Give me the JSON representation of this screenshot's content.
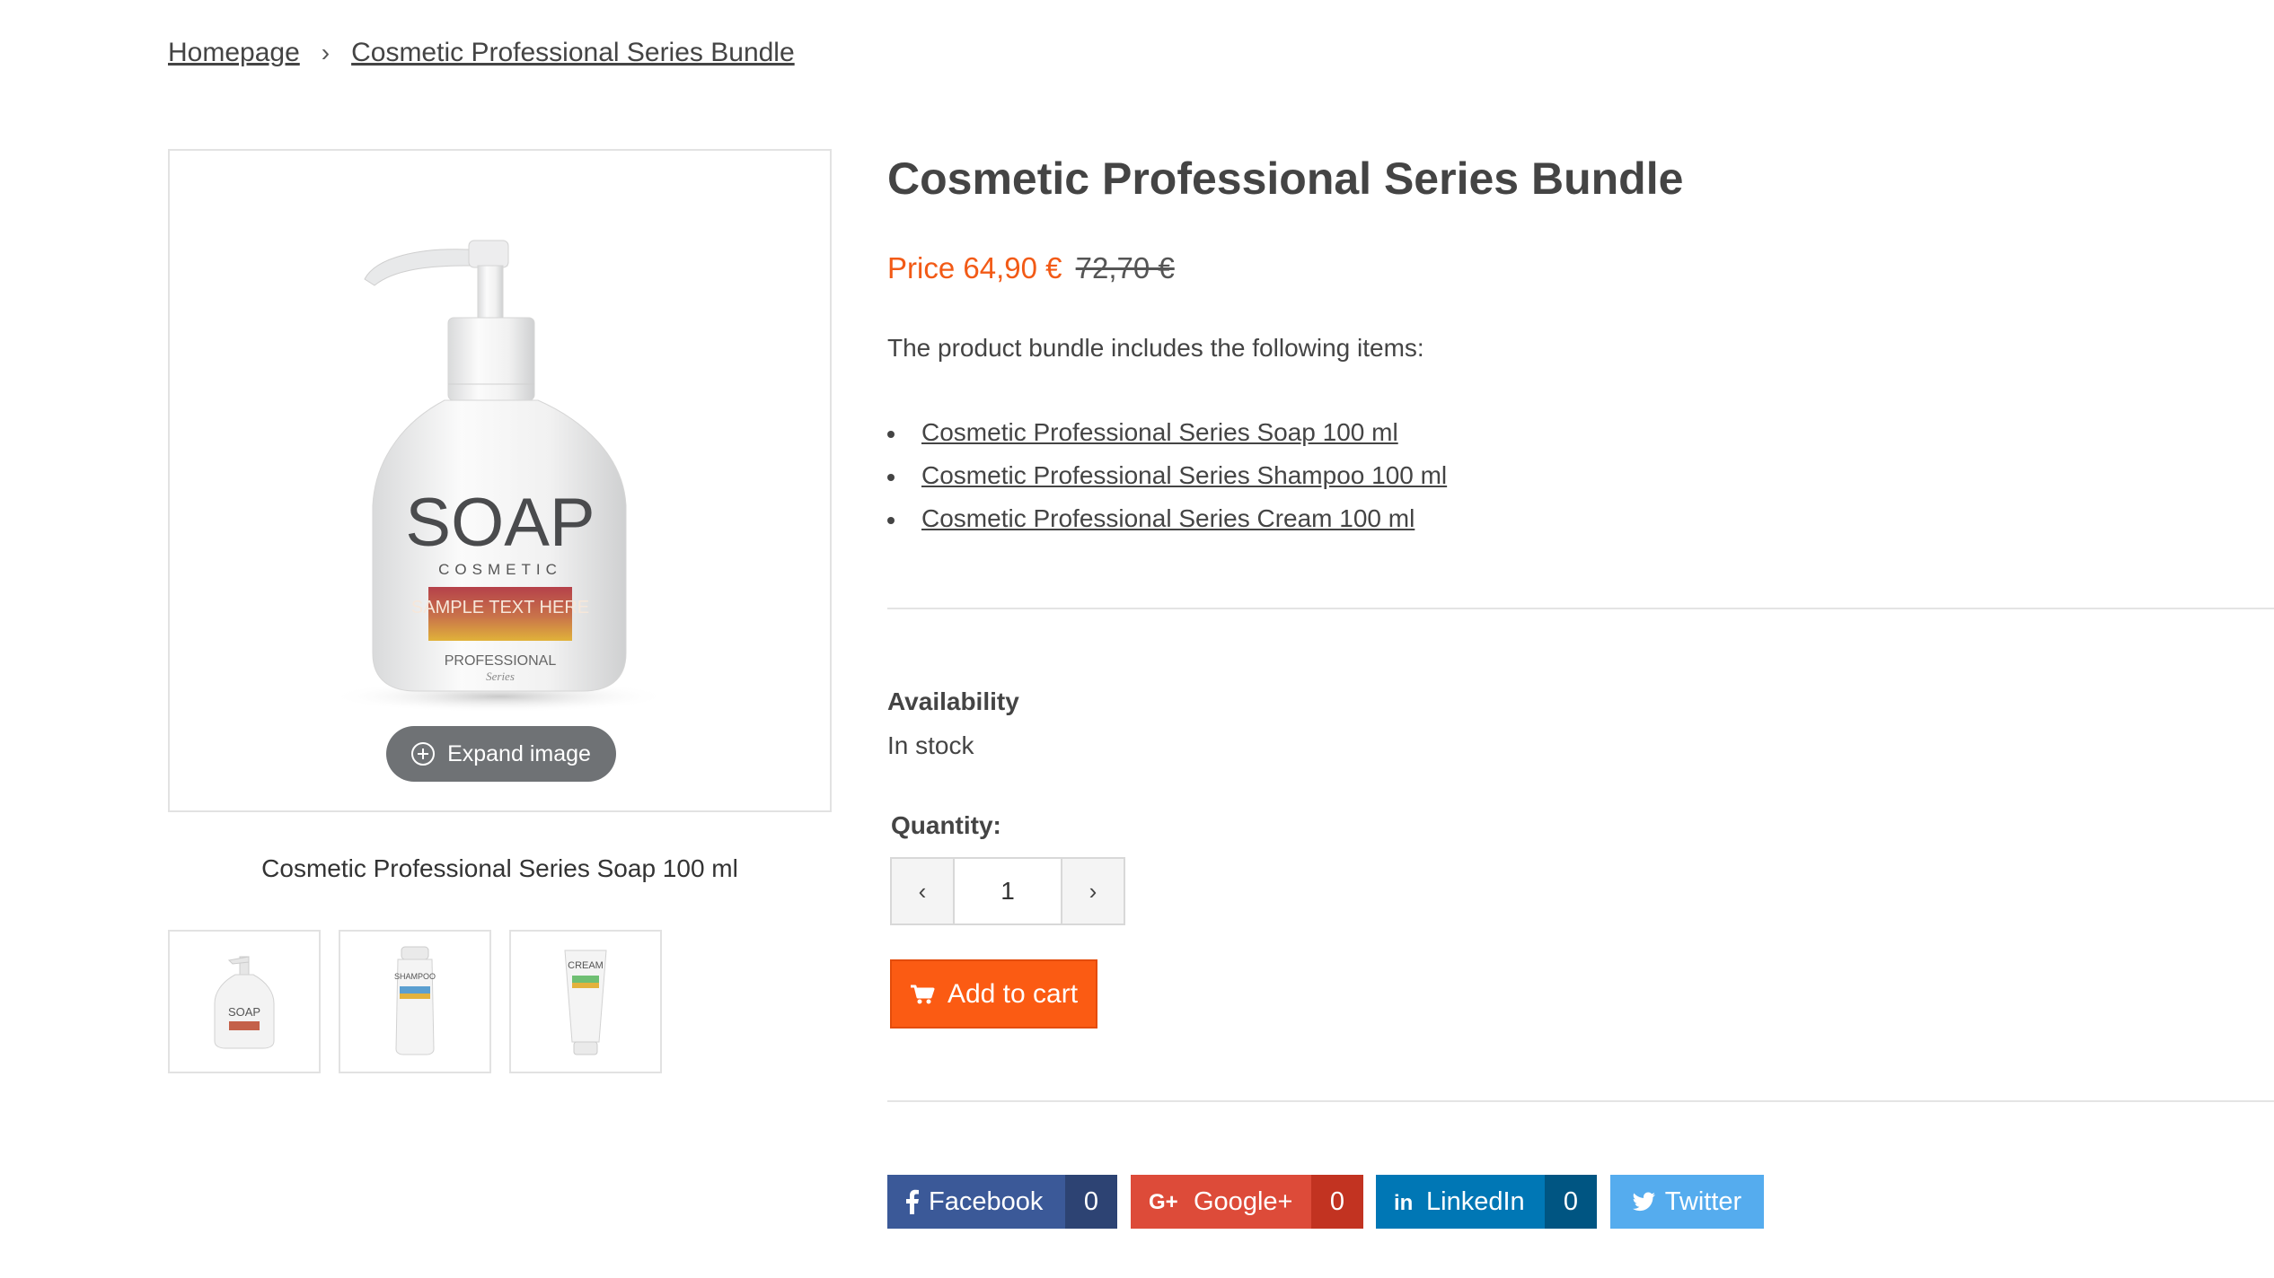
{
  "breadcrumb": {
    "items": [
      "Homepage",
      "Cosmetic Professional Series Bundle"
    ],
    "separator": "›"
  },
  "gallery": {
    "expand_label": "Expand image",
    "caption": "Cosmetic Professional Series Soap 100 ml",
    "main_image": {
      "label_big": "SOAP",
      "label_sub": "COSMETIC",
      "label_band": "SAMPLE TEXT HERE",
      "label_brand": "PROFESSIONAL",
      "label_script": "Series"
    },
    "thumbnails": [
      {
        "label": "SOAP"
      },
      {
        "label": "SHAMPOO"
      },
      {
        "label": "CREAM"
      }
    ]
  },
  "product": {
    "title": "Cosmetic Professional Series Bundle",
    "price_label": "Price",
    "price_now": "64,90 €",
    "price_old": "72,70 €",
    "bundle_intro": "The product bundle includes the following items:",
    "bundle_items": [
      "Cosmetic Professional Series Soap 100 ml",
      "Cosmetic Professional Series Shampoo 100 ml",
      "Cosmetic Professional Series Cream 100 ml"
    ],
    "availability_label": "Availability",
    "availability_value": "In stock",
    "quantity_label": "Quantity:",
    "quantity_value": "1",
    "quantity_decrease": "‹",
    "quantity_increase": "›",
    "add_to_cart": "Add to cart"
  },
  "share": [
    {
      "name": "Facebook",
      "count": "0",
      "color": "#3b5998",
      "count_color": "#2d4373"
    },
    {
      "name": "Google+",
      "count": "0",
      "color": "#dd4b39",
      "count_color": "#c23321"
    },
    {
      "name": "LinkedIn",
      "count": "0",
      "color": "#0077b5",
      "count_color": "#005582"
    },
    {
      "name": "Twitter",
      "color": "#55acee"
    }
  ],
  "colors": {
    "accent": "#f25a16",
    "button": "#fb5b13"
  }
}
